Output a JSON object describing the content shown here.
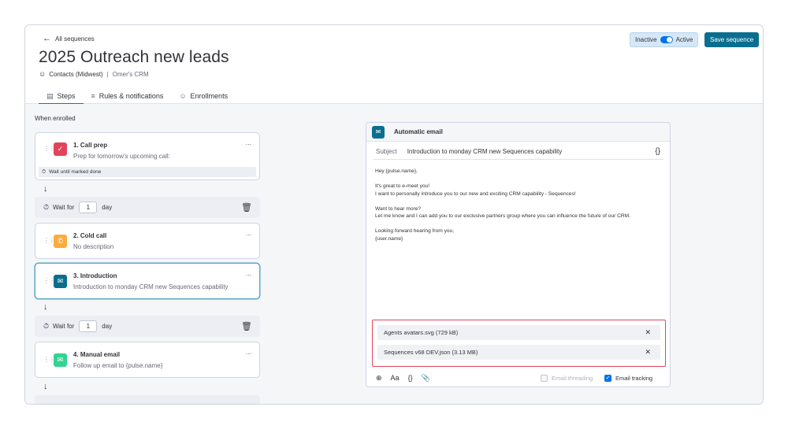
{
  "header": {
    "back_label": "All sequences",
    "title": "2025 Outreach new leads",
    "contacts": "Contacts (Midwest)",
    "separator": "|",
    "crm": "Omer's CRM",
    "status_inactive": "Inactive",
    "status_active": "Active",
    "save_label": "Save sequence"
  },
  "tabs": [
    {
      "label": "Steps",
      "icon": "list-icon",
      "active": true
    },
    {
      "label": "Rules & notifications",
      "icon": "sliders-icon",
      "active": false
    },
    {
      "label": "Enrollments",
      "icon": "person-icon",
      "active": false
    }
  ],
  "steps_panel": {
    "when_enrolled": "When enrolled",
    "steps": [
      {
        "title": "1. Call prep",
        "desc": "Prep for tomorrow's upcoming call:",
        "wait_note": "Wait until marked done",
        "color": "#e2445c",
        "icon": "checkbox-icon"
      },
      {
        "title": "2. Cold call",
        "desc": "No description",
        "color": "#fdab3d",
        "icon": "phone-icon"
      },
      {
        "title": "3. Introduction",
        "desc": "Introduction to monday CRM new Sequences capability",
        "color": "#0a6f8f",
        "icon": "email-automation-icon"
      },
      {
        "title": "4. Manual email",
        "desc": "Follow up email to {pulse.name}",
        "color": "#33d391",
        "icon": "envelope-icon"
      }
    ],
    "waits": [
      {
        "label": "Wait for",
        "value": "1",
        "unit": "day"
      },
      {
        "label": "Wait for",
        "value": "1",
        "unit": "day"
      }
    ],
    "more_label": "···"
  },
  "email": {
    "header_title": "Automatic email",
    "subject_label": "Subject",
    "subject_value": "Introduction to monday CRM new Sequences capability",
    "braces": "{}",
    "body_lines": [
      "Hey {pulse.name},",
      "",
      "It's great to e-meet you!",
      "I want to personally introduce you to our new and exciting CRM capability - Sequences!",
      "",
      "Want to hear more?",
      "Let me know and I can add you to our exclusive partners group where you can influence the future of our CRM.",
      "",
      "Looking forward hearing from you,",
      "{user.name}"
    ],
    "attachments": [
      {
        "name": "Agents avatars.svg (729 kB)"
      },
      {
        "name": "Sequences v68 DEV.json (3.13 MB)"
      }
    ],
    "toolbar": {
      "font_label": "Aa",
      "var_label": "{}"
    },
    "email_threading_label": "Email threading",
    "email_threading_checked": false,
    "email_tracking_label": "Email tracking",
    "email_tracking_checked": true,
    "accent_color": "#0073ea",
    "highlight_color": "#e2445c"
  }
}
